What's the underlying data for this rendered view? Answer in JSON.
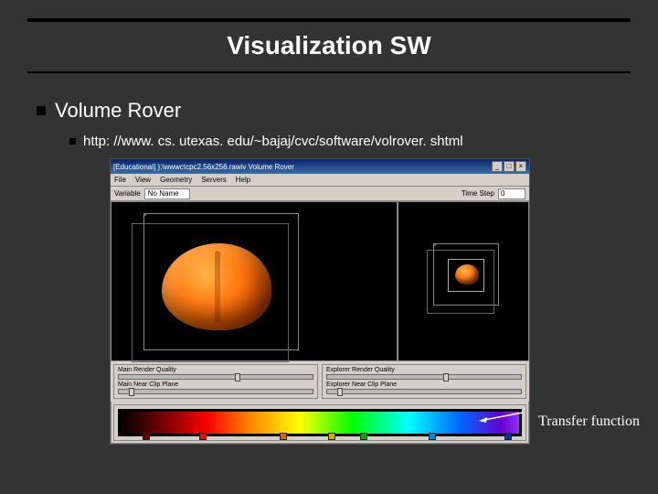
{
  "slide": {
    "title": "Visualization SW",
    "bullet1": "Volume Rover",
    "bullet2": "http: //www. cs. utexas. edu/~bajaj/cvc/software/volrover. shtml",
    "annotation": "Transfer function"
  },
  "app": {
    "titlebar": "[Educational]  }:\\wwwc\\cpc2.56x256.rawiv  Volume Rover",
    "menu": [
      "File",
      "View",
      "Geometry",
      "Servers",
      "Help"
    ],
    "toolbar": {
      "variable_label": "Variable",
      "variable_value": "No Name",
      "timestep_label": "Time Step",
      "timestep_value": "0"
    },
    "quality": {
      "left_top": "Main Render Quality",
      "left_bottom": "Main Near Clip Plane",
      "right_top": "Explorer Render Quality",
      "right_bottom": "Explorer Near Clip Plane"
    },
    "tf_markers": [
      {
        "pos": 6,
        "color": "#6a0000"
      },
      {
        "pos": 20,
        "color": "#ff0000"
      },
      {
        "pos": 40,
        "color": "#cc6600"
      },
      {
        "pos": 52,
        "color": "#d4aa00"
      },
      {
        "pos": 60,
        "color": "#00aa00"
      },
      {
        "pos": 77,
        "color": "#0088cc"
      },
      {
        "pos": 96,
        "color": "#0033aa"
      }
    ]
  }
}
